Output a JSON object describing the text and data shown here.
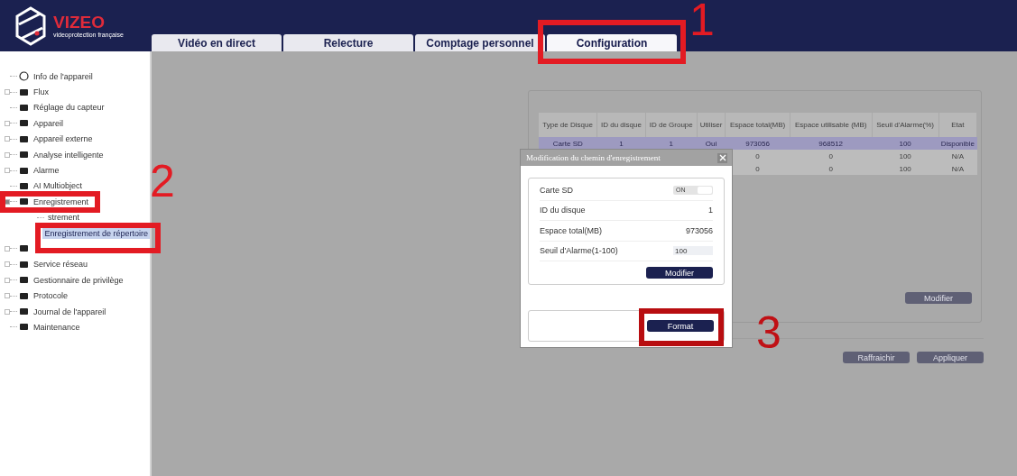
{
  "logo": {
    "name": "VIZEO",
    "tagline": "videoprotection française"
  },
  "tabs": [
    {
      "label": "Vidéo en direct",
      "selected": false
    },
    {
      "label": "Relecture",
      "selected": false
    },
    {
      "label": "Comptage personnel",
      "selected": false
    },
    {
      "label": "Configuration",
      "selected": true
    }
  ],
  "sidebar": {
    "items": [
      {
        "label": "Info de l'appareil",
        "selected": false
      },
      {
        "label": "Flux",
        "selected": false,
        "expanded": false
      },
      {
        "label": "Réglage du capteur",
        "selected": false
      },
      {
        "label": "Appareil",
        "selected": false,
        "expanded": false
      },
      {
        "label": "Appareil externe",
        "selected": false,
        "expanded": false
      },
      {
        "label": "Analyse intelligente",
        "selected": false,
        "expanded": false
      },
      {
        "label": "Alarme",
        "selected": false,
        "expanded": false
      },
      {
        "label": "AI Multiobject",
        "selected": false
      },
      {
        "label": "Enregistrement",
        "selected": false,
        "expanded": true,
        "children": [
          {
            "label": "strement",
            "selected": false
          },
          {
            "label": "Enregistrement de répertoire",
            "selected": true
          }
        ]
      },
      {
        "selected": false,
        "expanded": false
      },
      {
        "label": "Service réseau",
        "selected": false,
        "expanded": false
      },
      {
        "label": "Gestionnaire de privilège",
        "selected": false,
        "expanded": false
      },
      {
        "label": "Protocole",
        "selected": false,
        "expanded": false
      },
      {
        "label": "Journal de l'appareil",
        "selected": false,
        "expanded": false
      },
      {
        "label": "Maintenance",
        "selected": false
      }
    ]
  },
  "table": {
    "columns": [
      "Type de Disque",
      "ID du disque",
      "ID de Groupe",
      "Utiliser",
      "Espace total(MB)",
      "Espace utilisable (MB)",
      "Seuil d'Alarme(%)",
      "Etat"
    ],
    "rows": [
      {
        "selected": true,
        "cells": [
          "Carte SD",
          "1",
          "1",
          "Oui",
          "973056",
          "968512",
          "100",
          "Disponible"
        ]
      },
      {
        "selected": false,
        "cells": [
          "0",
          "0",
          "100",
          "N/A"
        ]
      },
      {
        "selected": false,
        "cells": [
          "0",
          "0",
          "100",
          "N/A"
        ]
      }
    ]
  },
  "panel_button": "Modifier",
  "buttons": [
    "Raffraichir",
    "Appliquer"
  ],
  "dialog": {
    "title": "Modification du chemin d'enregistrement",
    "fields": [
      {
        "kind": "toggle",
        "label": "Carte SD",
        "on": true,
        "value": "ON"
      },
      {
        "kind": "text",
        "label": "ID du disque",
        "value": "1"
      },
      {
        "kind": "text",
        "label": "Espace total(MB)",
        "value": "973056"
      },
      {
        "kind": "input",
        "label": "Seuil d'Alarme(1-100)",
        "value": "100"
      }
    ],
    "modify_button": "Modifier",
    "format_button": "Format"
  },
  "annotations": [
    {
      "number": "1"
    },
    {
      "number": "2"
    },
    {
      "number": "3"
    }
  ]
}
